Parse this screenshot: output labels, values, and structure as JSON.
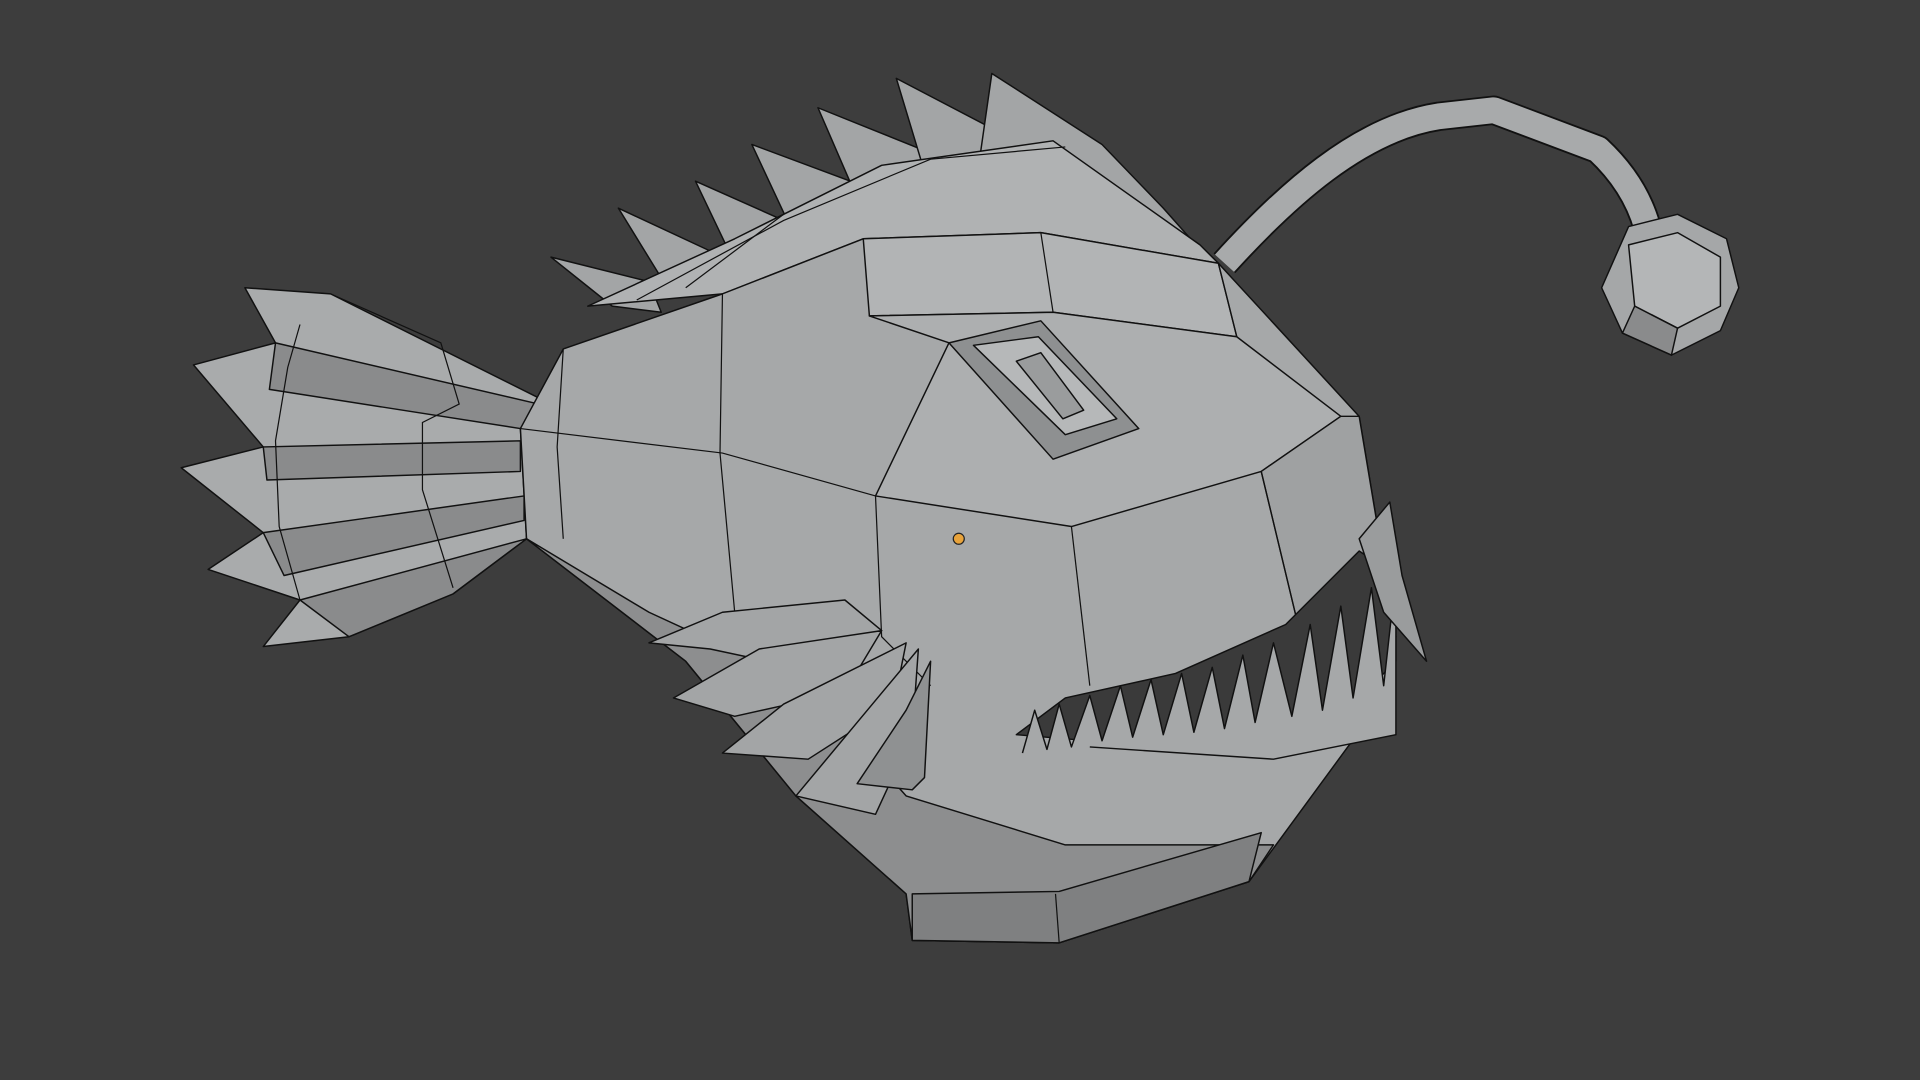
{
  "viewport": {
    "background": "#3d3d3d",
    "mesh_light": "#b4b6b7",
    "mesh_mid": "#9c9d9e",
    "mesh_dark": "#7c7d7e",
    "mouth_dark": "#3a3a3a",
    "edge_color": "#111111",
    "origin_color": "#e8a33b"
  },
  "object": {
    "origin_icon": "object-origin-dot"
  }
}
